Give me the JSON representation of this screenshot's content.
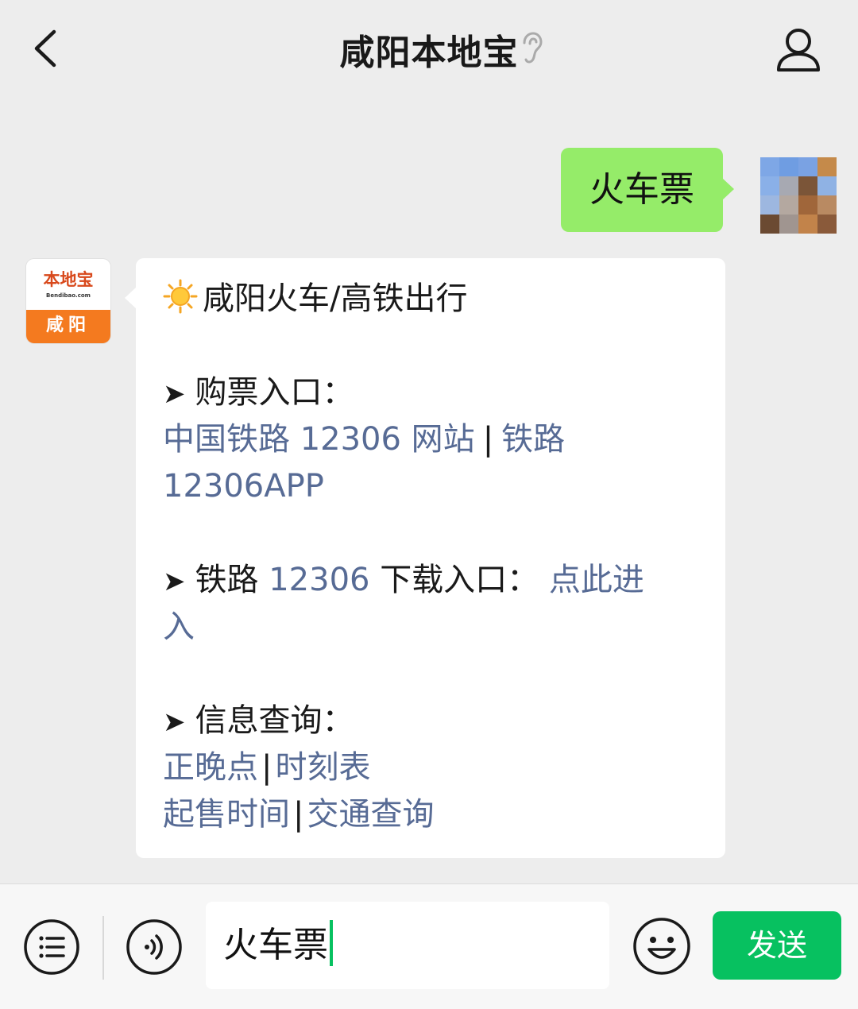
{
  "header": {
    "title": "咸阳本地宝",
    "back_icon": "chevron-left-icon",
    "ear_icon": "earpiece-icon",
    "profile_icon": "user-profile-icon"
  },
  "chat": {
    "user_message": "火车票",
    "bot_avatar": {
      "brand": "本地宝",
      "url": "Bendibao.com",
      "city": "咸阳"
    },
    "bot_message": {
      "title": "咸阳火车/高铁出行",
      "section1_label": "购票入口：",
      "links1": [
        "中国铁路 12306 网站",
        "铁路",
        "12306APP"
      ],
      "separator": "|",
      "section2_prefix": "铁路",
      "section2_link": "12306",
      "section2_suffix": "下载入口：",
      "section2_link2a": "点此进",
      "section2_link2b": "入",
      "section3_label": "信息查询：",
      "links3": [
        "正晚点",
        "时刻表",
        "起售时间",
        "交通查询"
      ]
    }
  },
  "input_bar": {
    "text_value": "火车票",
    "send_label": "发送",
    "menu_icon": "list-menu-icon",
    "voice_icon": "voice-icon",
    "emoji_icon": "emoji-icon"
  },
  "colors": {
    "background": "#ededed",
    "user_bubble": "#95ec69",
    "link": "#576b95",
    "send_button": "#07c160",
    "bot_avatar_orange": "#f47a1f"
  }
}
